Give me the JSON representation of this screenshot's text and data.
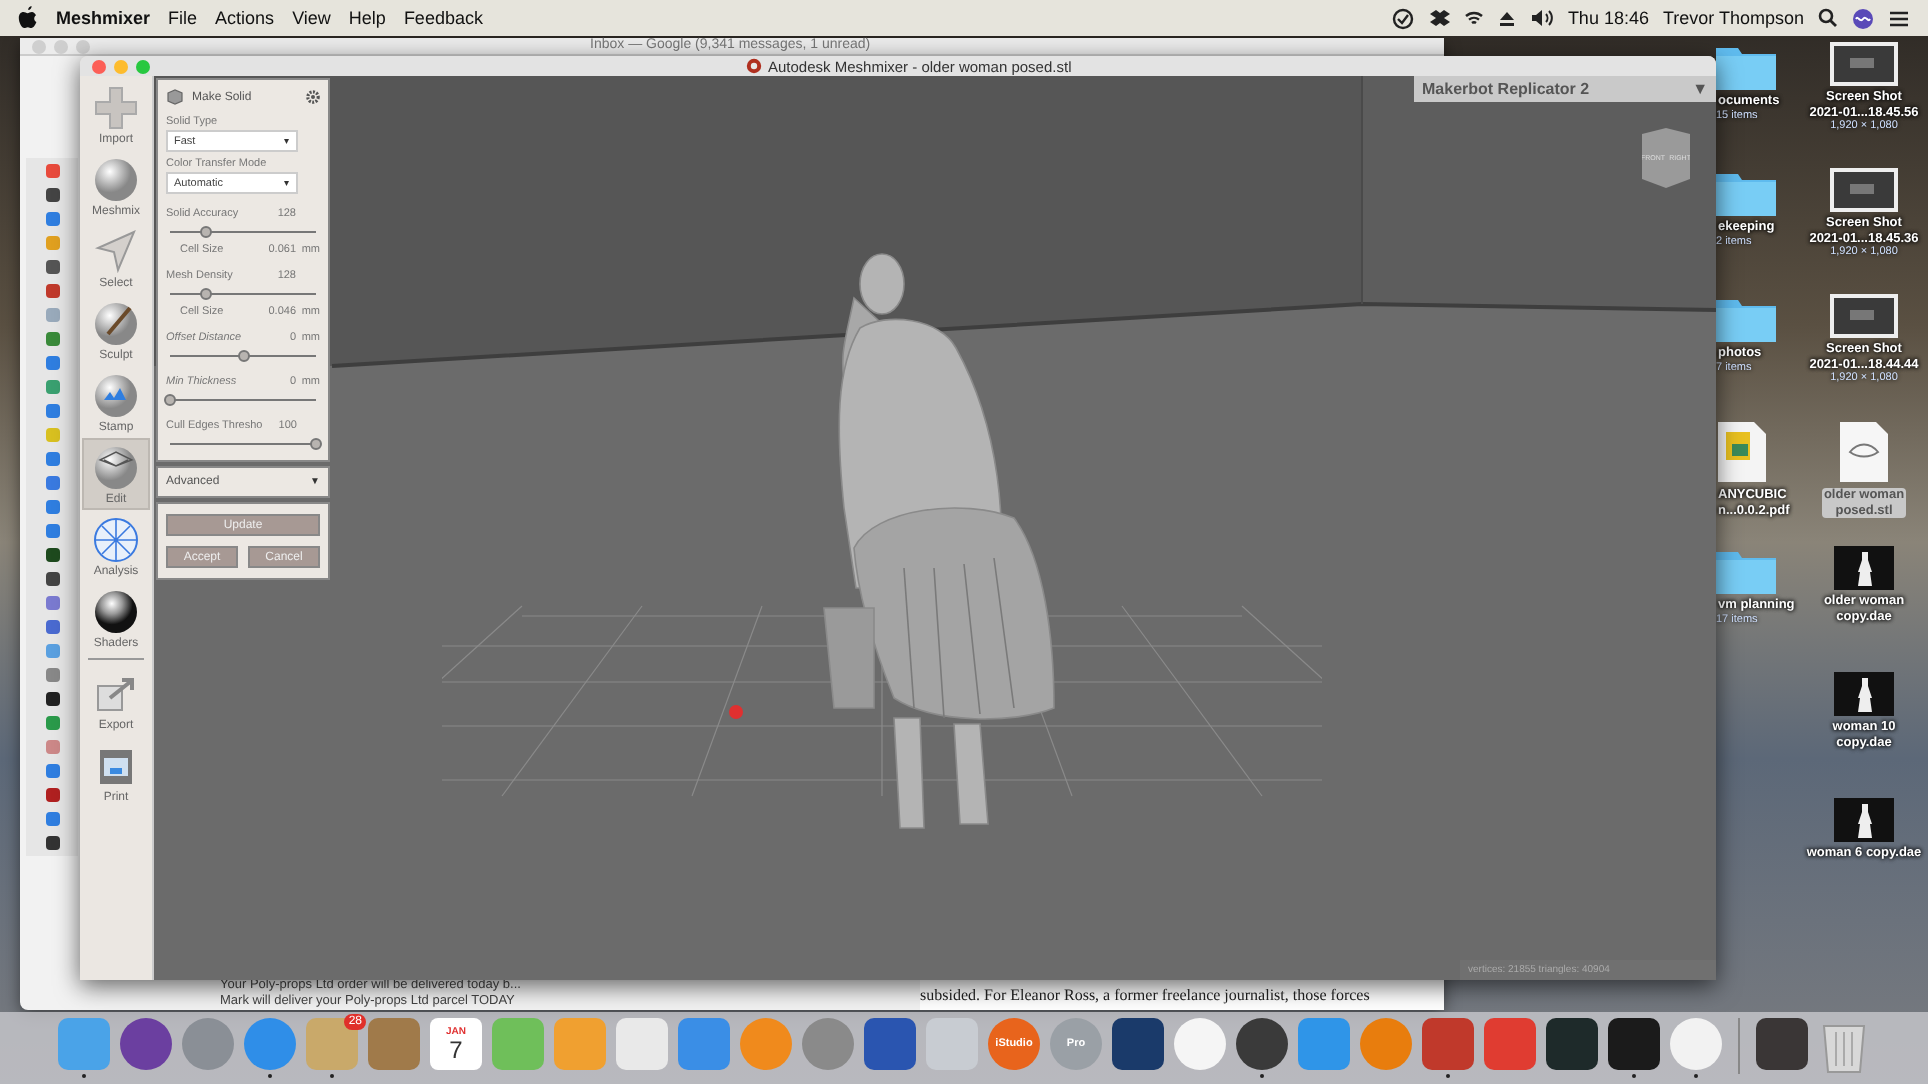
{
  "menu_bar": {
    "app_name": "Meshmixer",
    "menus": [
      "File",
      "Actions",
      "View",
      "Help",
      "Feedback"
    ],
    "clock": "Thu 18:46",
    "user": "Trevor Thompson"
  },
  "mail_window": {
    "title": "Inbox — Google (9,341 messages, 1 unread)",
    "previews": [
      "Your Poly-props Ltd order will be delivered today b...",
      "Mark will deliver your Poly-props Ltd parcel TODAY"
    ],
    "message_text": "subsided. For Eleanor Ross, a former freelance journalist, those forces"
  },
  "meshmixer": {
    "title": "Autodesk Meshmixer - older woman posed.stl",
    "tools": [
      {
        "label": "Import",
        "selected": false
      },
      {
        "label": "Meshmix",
        "selected": false
      },
      {
        "label": "Select",
        "selected": false
      },
      {
        "label": "Sculpt",
        "selected": false
      },
      {
        "label": "Stamp",
        "selected": false
      },
      {
        "label": "Edit",
        "selected": true
      },
      {
        "label": "Analysis",
        "selected": false
      },
      {
        "label": "Shaders",
        "selected": false
      },
      {
        "label": "Export",
        "selected": false
      },
      {
        "label": "Print",
        "selected": false
      }
    ],
    "panel": {
      "title": "Make Solid",
      "dropdowns": [
        {
          "label": "Solid Type",
          "value": "Fast",
          "caret": "▾"
        },
        {
          "label": "Color Transfer Mode",
          "value": "Automatic",
          "caret": "▾"
        }
      ],
      "params": [
        {
          "kind": "slider",
          "label": "Solid Accuracy",
          "value": "128",
          "italic": false,
          "level": 0.25
        },
        {
          "kind": "readout",
          "label": "Cell Size",
          "value": "0.061",
          "unit": "mm"
        },
        {
          "kind": "slider",
          "label": "Mesh Density",
          "value": "128",
          "italic": false,
          "level": 0.25
        },
        {
          "kind": "readout",
          "label": "Cell Size",
          "value": "0.046",
          "unit": "mm"
        },
        {
          "kind": "slider",
          "label": "Offset Distance",
          "value": "0",
          "unit": "mm",
          "italic": true,
          "level": 0.5
        },
        {
          "kind": "slider",
          "label": "Min Thickness",
          "value": "0",
          "unit": "mm",
          "italic": true,
          "level": 0
        },
        {
          "kind": "slider",
          "label": "Cull Edges Thresho",
          "value": "100",
          "italic": false,
          "level": 1
        }
      ],
      "advanced": {
        "label": "Advanced",
        "caret": "▼"
      },
      "buttons": [
        {
          "label": "Update",
          "kind": "wide"
        },
        {
          "label": "Accept",
          "kind": "half"
        },
        {
          "label": "Cancel",
          "kind": "half"
        }
      ]
    },
    "printer": {
      "label": "Makerbot Replicator 2",
      "caret": "▼"
    },
    "view_cube": [
      "FRONT",
      "RIGHT"
    ],
    "status": "vertices: 21855 triangles: 40904"
  },
  "desktop": {
    "left_column": [
      {
        "kind": "folder",
        "lines": [
          "ocuments"
        ],
        "detail": "15 items",
        "selected": false
      },
      {
        "kind": "folder",
        "lines": [
          "ekeeping"
        ],
        "detail": "2 items",
        "selected": false
      },
      {
        "kind": "folder",
        "lines": [
          "photos"
        ],
        "detail": "7 items",
        "selected": false
      },
      {
        "kind": "pdf",
        "lines": [
          "ANYCUBIC",
          "n...0.0.2.pdf"
        ],
        "selected": false
      },
      {
        "kind": "folder",
        "lines": [
          "vm planning"
        ],
        "detail": "17 items",
        "selected": false
      }
    ],
    "right_column": [
      {
        "kind": "screenshot",
        "lines": [
          "Screen Shot",
          "2021-01...18.45.56"
        ],
        "detail": "1,920 × 1,080",
        "selected": false
      },
      {
        "kind": "screenshot",
        "lines": [
          "Screen Shot",
          "2021-01...18.45.36"
        ],
        "detail": "1,920 × 1,080",
        "selected": false
      },
      {
        "kind": "screenshot",
        "lines": [
          "Screen Shot",
          "2021-01...18.44.44"
        ],
        "detail": "1,920 × 1,080",
        "selected": false
      },
      {
        "kind": "model",
        "lines": [
          "older woman",
          "posed.stl"
        ],
        "selected": true
      },
      {
        "kind": "figure",
        "lines": [
          "older woman",
          "copy.dae"
        ],
        "selected": false
      },
      {
        "kind": "figure",
        "lines": [
          "woman 10",
          "copy.dae"
        ],
        "selected": false
      },
      {
        "kind": "figure",
        "lines": [
          "woman 6 copy.dae"
        ],
        "selected": false
      }
    ]
  },
  "dock": {
    "apps": [
      {
        "kind": "square",
        "color": "#4aa3e8",
        "running": true
      },
      {
        "kind": "round",
        "color": "#6b3fa0",
        "running": false
      },
      {
        "kind": "round",
        "color": "#8a8f96",
        "running": false
      },
      {
        "kind": "round",
        "color": "#2f8ee8",
        "running": true
      },
      {
        "kind": "square",
        "color": "#c9a96a",
        "badge": "28",
        "running": true
      },
      {
        "kind": "square",
        "color": "#a07a4a",
        "running": false
      },
      {
        "kind": "calendar",
        "month": "JAN",
        "day": "7",
        "running": false
      },
      {
        "kind": "square",
        "color": "#6fbf5a",
        "running": false
      },
      {
        "kind": "square",
        "color": "#f0a030",
        "running": false
      },
      {
        "kind": "square",
        "color": "#e9e9e9",
        "running": false
      },
      {
        "kind": "square",
        "color": "#3a8ee6",
        "running": false
      },
      {
        "kind": "round",
        "color": "#f08a1c",
        "running": false
      },
      {
        "kind": "round",
        "color": "#8a8a8a",
        "running": false
      },
      {
        "kind": "square",
        "color": "#2a55b0",
        "running": false
      },
      {
        "kind": "square",
        "color": "#c8ccd2",
        "running": false
      },
      {
        "kind": "round",
        "color": "#e8641c",
        "label": "iStudio",
        "running": false
      },
      {
        "kind": "round",
        "color": "#9aa0a6",
        "label": "Pro",
        "running": false
      },
      {
        "kind": "square",
        "color": "#1a3a6a",
        "running": false
      },
      {
        "kind": "round",
        "color": "#f5f5f5",
        "running": false
      },
      {
        "kind": "round",
        "color": "#3a3a3a",
        "running": true
      },
      {
        "kind": "square",
        "color": "#2f95e8",
        "running": false
      },
      {
        "kind": "round",
        "color": "#e87d0d",
        "running": false
      },
      {
        "kind": "square",
        "color": "#c0392b",
        "running": true
      },
      {
        "kind": "square",
        "color": "#e03c31",
        "running": false
      },
      {
        "kind": "square",
        "color": "#1e2a2a",
        "running": false
      },
      {
        "kind": "square",
        "color": "#1b1b1b",
        "running": true
      },
      {
        "kind": "round",
        "color": "#f2f2f2",
        "running": true
      }
    ],
    "others": [
      {
        "kind": "square",
        "color": "#3a3636",
        "running": false
      },
      {
        "kind": "trash",
        "color": "#d8d8d8",
        "running": false
      }
    ]
  }
}
